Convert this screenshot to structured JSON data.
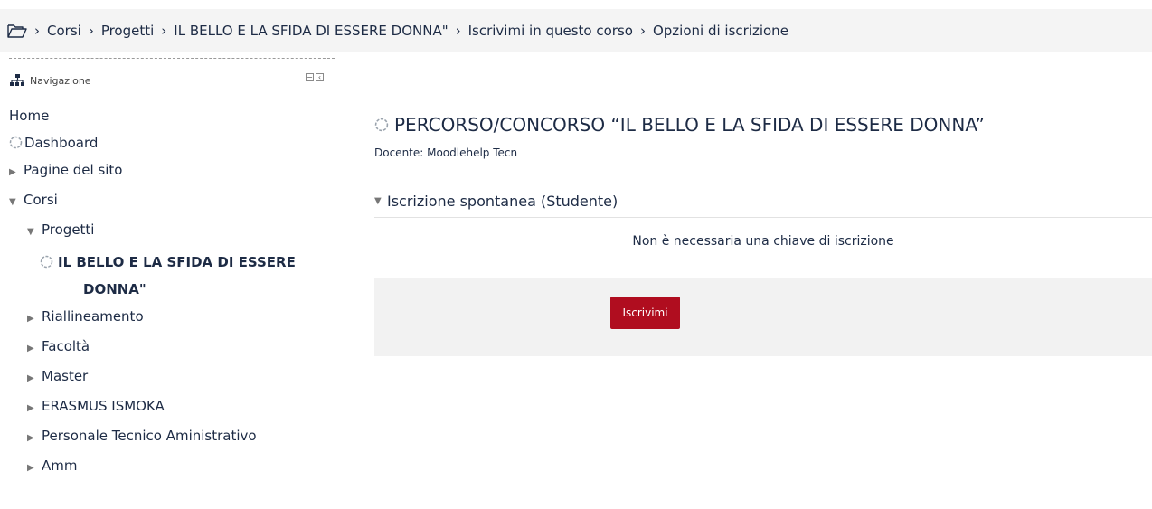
{
  "breadcrumb": {
    "icon": "folder-icon",
    "items": [
      "Corsi",
      "Progetti",
      "IL BELLO E LA SFIDA DI ESSERE DONNA\"",
      "Iscrivimi in questo corso",
      "Opzioni di iscrizione"
    ]
  },
  "nav": {
    "title": "Navigazione",
    "home": "Home",
    "dashboard": "Dashboard",
    "site_pages": "Pagine del sito",
    "courses": "Corsi",
    "projects": "Progetti",
    "current_course_line1": "IL BELLO E LA SFIDA DI ESSERE",
    "current_course_line2": "DONNA\"",
    "categories": [
      "Riallineamento",
      "Facoltà",
      "Master",
      "ERASMUS ISMOKA",
      "Personale Tecnico Aministrativo",
      "Amm"
    ]
  },
  "main": {
    "course_title": "PERCORSO/CONCORSO “IL BELLO E LA SFIDA DI ESSERE DONNA”",
    "teacher": "Docente: Moodlehelp Tecn",
    "section_title": "Iscrizione spontanea (Studente)",
    "no_key_note": "Non è necessaria una chiave di iscrizione",
    "enrol_button": "Iscrivimi"
  },
  "colors": {
    "primary_text": "#1d2b45",
    "button_bg": "#b00d1f",
    "bar_bg": "#f4f4f4"
  }
}
